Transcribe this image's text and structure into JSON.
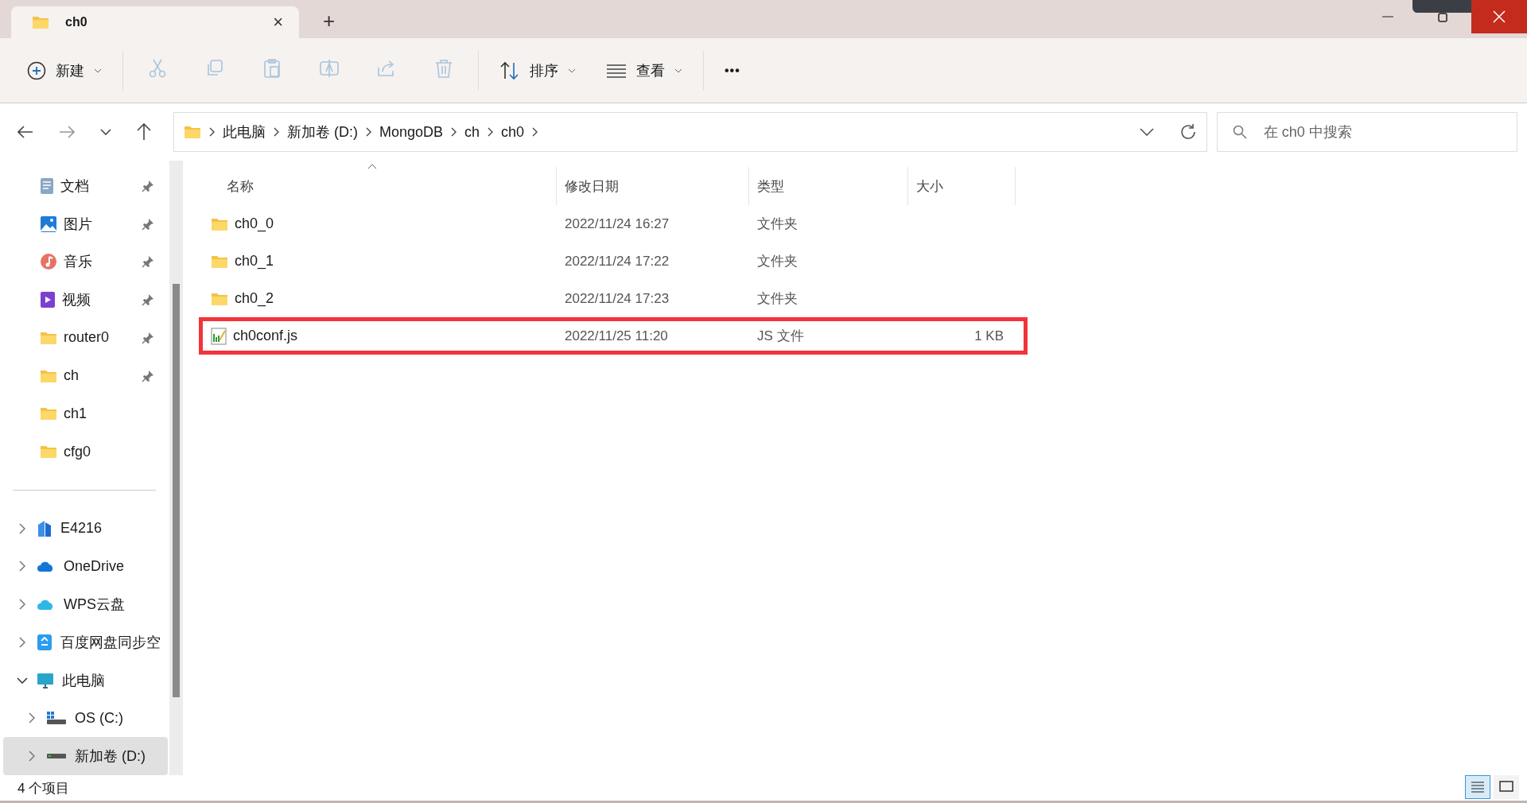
{
  "tab": {
    "title": "ch0",
    "close": "×"
  },
  "new_tab": "+",
  "toolbar": {
    "new": {
      "label": "新建"
    },
    "actions": [
      {
        "kind": "cut",
        "disabled": true
      },
      {
        "kind": "copy",
        "disabled": true
      },
      {
        "kind": "paste",
        "disabled": true
      },
      {
        "kind": "rename",
        "disabled": true
      },
      {
        "kind": "share",
        "disabled": true
      },
      {
        "kind": "delete",
        "disabled": true
      }
    ],
    "sort": {
      "label": "排序"
    },
    "view": {
      "label": "查看"
    },
    "more": "•••"
  },
  "breadcrumb": [
    "此电脑",
    "新加卷 (D:)",
    "MongoDB",
    "ch",
    "ch0"
  ],
  "search": {
    "placeholder": "在 ch0 中搜索"
  },
  "quick_access": [
    {
      "label": "文档",
      "kind": "documents",
      "pinned": true
    },
    {
      "label": "图片",
      "kind": "pictures",
      "pinned": true
    },
    {
      "label": "音乐",
      "kind": "music",
      "pinned": true
    },
    {
      "label": "视频",
      "kind": "videos",
      "pinned": true
    },
    {
      "label": "router0",
      "kind": "folder",
      "pinned": true
    },
    {
      "label": "ch",
      "kind": "folder",
      "pinned": true
    },
    {
      "label": "ch1",
      "kind": "folder",
      "pinned": false
    },
    {
      "label": "cfg0",
      "kind": "folder",
      "pinned": false
    }
  ],
  "tree": [
    {
      "label": "E4216",
      "kind": "building",
      "expanded": false,
      "selected": false
    },
    {
      "label": "OneDrive",
      "kind": "cloud",
      "expanded": false,
      "selected": false
    },
    {
      "label": "WPS云盘",
      "kind": "wps",
      "expanded": false,
      "selected": false
    },
    {
      "label": "百度网盘同步空",
      "kind": "sync",
      "expanded": false,
      "selected": false
    },
    {
      "label": "此电脑",
      "kind": "pc",
      "expanded": true,
      "selected": false,
      "children": [
        {
          "label": "OS (C:)",
          "kind": "osdrive",
          "expanded": false,
          "selected": false
        },
        {
          "label": "新加卷 (D:)",
          "kind": "drive",
          "expanded": false,
          "selected": true
        }
      ]
    }
  ],
  "table": {
    "columns": [
      "名称",
      "修改日期",
      "类型",
      "大小"
    ],
    "rows": [
      {
        "name": "ch0_0",
        "kind": "folder",
        "modified": "2022/11/24 16:27",
        "type": "文件夹",
        "highlighted": false
      },
      {
        "name": "ch0_1",
        "kind": "folder",
        "modified": "2022/11/24 17:22",
        "type": "文件夹",
        "highlighted": false
      },
      {
        "name": "ch0_2",
        "kind": "folder",
        "modified": "2022/11/24 17:23",
        "type": "文件夹",
        "highlighted": false
      },
      {
        "name": "ch0conf.js",
        "kind": "script",
        "modified": "2022/11/25 11:20",
        "type": "JS 文件",
        "size": "1 KB",
        "highlighted": true
      }
    ]
  },
  "status_bar": {
    "count": "4 个项目",
    "views": [
      {
        "kind": "details",
        "selected": true
      },
      {
        "kind": "tiles",
        "selected": false
      }
    ]
  }
}
